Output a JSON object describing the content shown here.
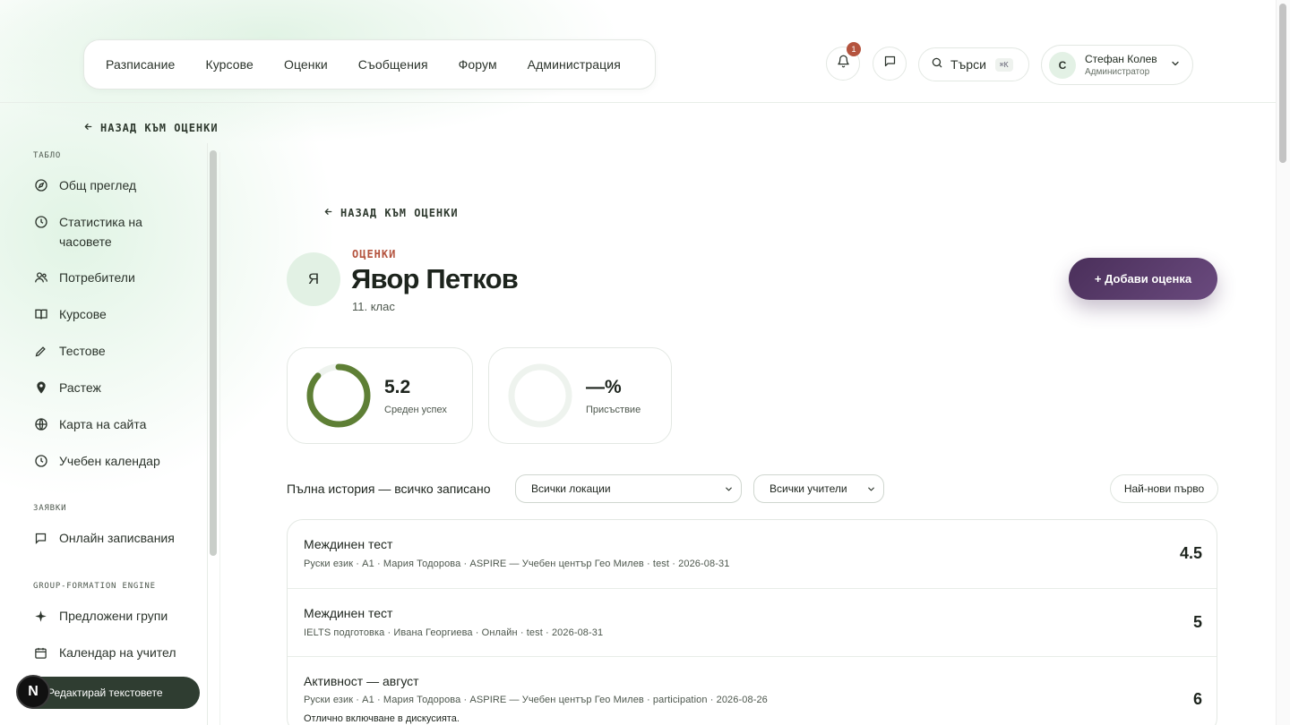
{
  "nav": {
    "items": [
      "Разписание",
      "Курсове",
      "Оценки",
      "Съобщения",
      "Форум",
      "Администрация"
    ]
  },
  "header": {
    "notifications_count": "1",
    "search_label": "Търси",
    "search_shortcut": "⌘K",
    "user_initial": "С",
    "user_name": "Стефан Колев",
    "user_role": "Администратор"
  },
  "back_label": "НАЗАД КЪМ ОЦЕНКИ",
  "sidebar": {
    "section_dashboard": "ТАБЛО",
    "dashboard_items": [
      {
        "label": "Общ преглед",
        "icon": "compass-icon"
      },
      {
        "label": "Статистика на часовете",
        "icon": "clock-icon"
      },
      {
        "label": "Потребители",
        "icon": "users-icon"
      },
      {
        "label": "Курсове",
        "icon": "book-icon"
      },
      {
        "label": "Тестове",
        "icon": "pencil-icon"
      },
      {
        "label": "Растеж",
        "icon": "pin-icon"
      },
      {
        "label": "Карта на сайта",
        "icon": "globe-icon"
      },
      {
        "label": "Учебен календар",
        "icon": "clock-icon"
      }
    ],
    "section_requests": "ЗАЯВКИ",
    "requests_items": [
      {
        "label": "Онлайн записвания",
        "icon": "chat-icon"
      }
    ],
    "section_engine": "GROUP-FORMATION ENGINE",
    "engine_items": [
      {
        "label": "Предложени групи",
        "icon": "sparkle-icon"
      },
      {
        "label": "Календар на учител",
        "icon": "calendar-icon"
      }
    ]
  },
  "student": {
    "initial": "Я",
    "eyebrow": "ОЦЕНКИ",
    "name": "Явор Петков",
    "class": "11. клас",
    "add_button": "+ Добави оценка"
  },
  "stats": {
    "average_value": "5.2",
    "average_label": "Среден успех",
    "average_fraction": 0.87,
    "attendance_value": "—%",
    "attendance_label": "Присъствие"
  },
  "filters": {
    "title": "Пълна история — всичко записано",
    "location_selected": "Всички локации",
    "teacher_selected": "Всички учители",
    "sort_label": "Най-нови първо"
  },
  "records": [
    {
      "title": "Междинен тест",
      "meta": "Руски език · A1 · Мария Тодорова · ASPIRE — Учебен център Гео Милев · test · 2026-08-31",
      "grade": "4.5",
      "note": ""
    },
    {
      "title": "Междинен тест",
      "meta": "IELTS подготовка · Ивана Георгиева · Онлайн · test · 2026-08-31",
      "grade": "5",
      "note": ""
    },
    {
      "title": "Активност — август",
      "meta": "Руски език · A1 · Мария Тодорова · ASPIRE — Учебен център Гео Милев · participation · 2026-08-26",
      "grade": "6",
      "note": "Отлично включване в дискусията."
    }
  ],
  "edit_texts_button": "Редактирай текстовете",
  "n_badge": "N",
  "colors": {
    "accent_purple": "#4a2f5a",
    "eyebrow_rust": "#b4533e",
    "ring_green": "#5e7f35",
    "sidebar_dark": "#2f3d31"
  }
}
